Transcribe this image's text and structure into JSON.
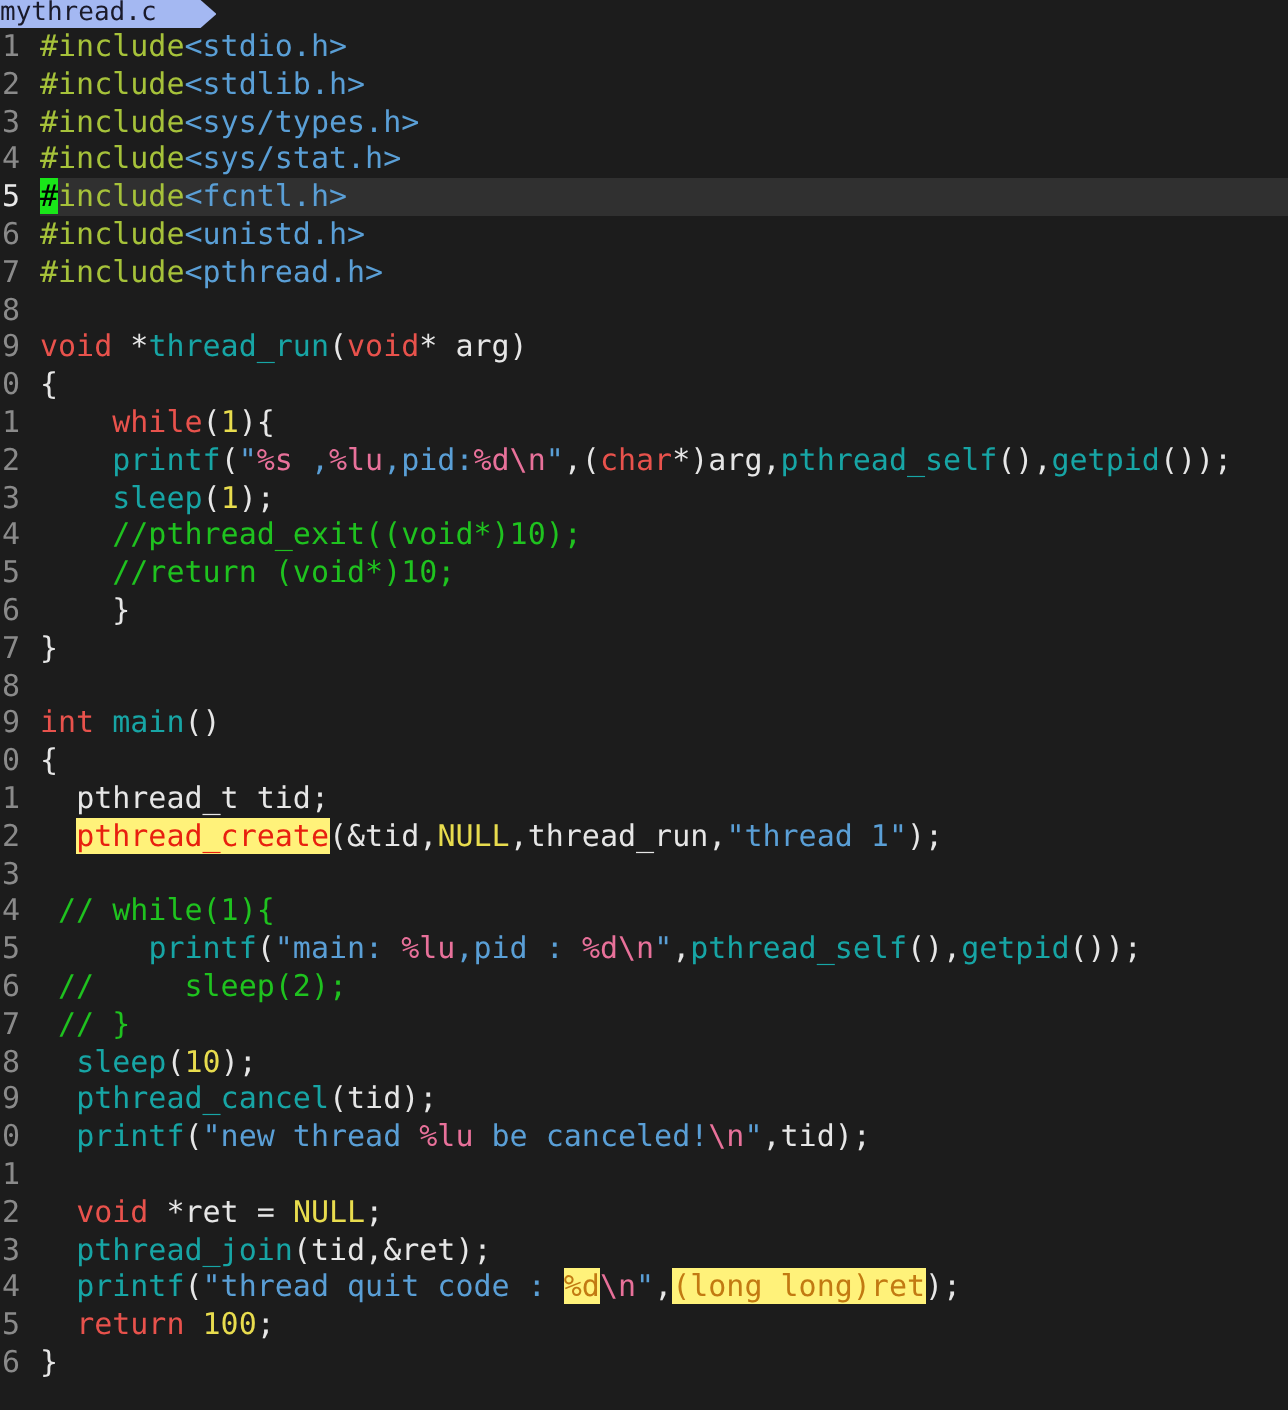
{
  "tab": {
    "title": "mythread.c"
  },
  "lines": [
    {
      "number": "1",
      "current": false,
      "segments": [
        {
          "text": "#include",
          "kind": "preproc"
        },
        {
          "text": "<stdio.h>",
          "kind": "header"
        }
      ]
    },
    {
      "number": "2",
      "current": false,
      "segments": [
        {
          "text": "#include",
          "kind": "preproc"
        },
        {
          "text": "<stdlib.h>",
          "kind": "header"
        }
      ]
    },
    {
      "number": "3",
      "current": false,
      "segments": [
        {
          "text": "#include",
          "kind": "preproc"
        },
        {
          "text": "<sys/types.h>",
          "kind": "header"
        }
      ]
    },
    {
      "number": "4",
      "current": false,
      "segments": [
        {
          "text": "#include",
          "kind": "preproc"
        },
        {
          "text": "<sys/stat.h>",
          "kind": "header"
        }
      ]
    },
    {
      "number": "5",
      "current": true,
      "segments": [
        {
          "text": "#",
          "kind": "cursor"
        },
        {
          "text": "include",
          "kind": "preproc"
        },
        {
          "text": "<fcntl.h>",
          "kind": "header"
        }
      ]
    },
    {
      "number": "6",
      "current": false,
      "segments": [
        {
          "text": "#include",
          "kind": "preproc"
        },
        {
          "text": "<unistd.h>",
          "kind": "header"
        }
      ]
    },
    {
      "number": "7",
      "current": false,
      "segments": [
        {
          "text": "#include",
          "kind": "preproc"
        },
        {
          "text": "<pthread.h>",
          "kind": "header"
        }
      ]
    },
    {
      "number": "8",
      "current": false
    },
    {
      "number": "9",
      "current": false,
      "segments": [
        {
          "text": "void",
          "kind": "keyword"
        },
        {
          "text": " *",
          "kind": "plain"
        },
        {
          "text": "thread_run",
          "kind": "function"
        },
        {
          "text": "(",
          "kind": "plain"
        },
        {
          "text": "void",
          "kind": "keyword"
        },
        {
          "text": "* arg)",
          "kind": "plain"
        }
      ]
    },
    {
      "number": "0",
      "current": false,
      "segments": [
        {
          "text": "{",
          "kind": "plain"
        }
      ]
    },
    {
      "number": "1",
      "current": false,
      "segments": [
        {
          "text": "    while",
          "kind": "keyword"
        },
        {
          "text": "(",
          "kind": "plain"
        },
        {
          "text": "1",
          "kind": "number"
        },
        {
          "text": "){",
          "kind": "plain"
        }
      ]
    },
    {
      "number": "2",
      "current": false,
      "segments": [
        {
          "text": "    printf",
          "kind": "function"
        },
        {
          "text": "(",
          "kind": "plain"
        },
        {
          "text": "\"",
          "kind": "string"
        },
        {
          "text": "%s",
          "kind": "format"
        },
        {
          "text": " ,",
          "kind": "string"
        },
        {
          "text": "%lu",
          "kind": "format"
        },
        {
          "text": ",pid:",
          "kind": "string"
        },
        {
          "text": "%d\\n",
          "kind": "format"
        },
        {
          "text": "\"",
          "kind": "string"
        },
        {
          "text": ",(",
          "kind": "plain"
        },
        {
          "text": "char",
          "kind": "keyword"
        },
        {
          "text": "*)arg,",
          "kind": "plain"
        },
        {
          "text": "pthread_self",
          "kind": "function"
        },
        {
          "text": "(),",
          "kind": "plain"
        },
        {
          "text": "getpid",
          "kind": "function"
        },
        {
          "text": "());",
          "kind": "plain"
        }
      ]
    },
    {
      "number": "3",
      "current": false,
      "segments": [
        {
          "text": "    sleep",
          "kind": "function"
        },
        {
          "text": "(",
          "kind": "plain"
        },
        {
          "text": "1",
          "kind": "number"
        },
        {
          "text": ");",
          "kind": "plain"
        }
      ]
    },
    {
      "number": "4",
      "current": false,
      "segments": [
        {
          "text": "    //pthread_exit((void*)10);",
          "kind": "comment"
        }
      ]
    },
    {
      "number": "5",
      "current": false,
      "segments": [
        {
          "text": "    //return (void*)10;",
          "kind": "comment"
        }
      ]
    },
    {
      "number": "6",
      "current": false,
      "segments": [
        {
          "text": "    }",
          "kind": "plain"
        }
      ]
    },
    {
      "number": "7",
      "current": false,
      "segments": [
        {
          "text": "}",
          "kind": "plain"
        }
      ]
    },
    {
      "number": "8",
      "current": false
    },
    {
      "number": "9",
      "current": false,
      "segments": [
        {
          "text": "int",
          "kind": "keyword"
        },
        {
          "text": " main",
          "kind": "function"
        },
        {
          "text": "()",
          "kind": "plain"
        }
      ]
    },
    {
      "number": "0",
      "current": false,
      "segments": [
        {
          "text": "{",
          "kind": "plain"
        }
      ]
    },
    {
      "number": "1",
      "current": false,
      "segments": [
        {
          "text": "  pthread_t tid;",
          "kind": "plain"
        }
      ]
    },
    {
      "number": "2",
      "current": false,
      "segments": [
        {
          "text": "  pthread_create",
          "kind": "function",
          "highlighted": true
        },
        {
          "text": "(&tid,",
          "kind": "plain"
        },
        {
          "text": "NULL",
          "kind": "number"
        },
        {
          "text": ",thread_run,",
          "kind": "plain"
        },
        {
          "text": "\"thread 1\"",
          "kind": "string"
        },
        {
          "text": ");",
          "kind": "plain"
        }
      ]
    },
    {
      "number": "3",
      "current": false
    },
    {
      "number": "4",
      "current": false,
      "segments": [
        {
          "text": " // while(1){",
          "kind": "comment"
        }
      ]
    },
    {
      "number": "5",
      "current": false,
      "segments": [
        {
          "text": "      printf",
          "kind": "function"
        },
        {
          "text": "(",
          "kind": "plain"
        },
        {
          "text": "\"main: ",
          "kind": "string"
        },
        {
          "text": "%lu",
          "kind": "format"
        },
        {
          "text": ",pid : ",
          "kind": "string"
        },
        {
          "text": "%d\\n",
          "kind": "format"
        },
        {
          "text": "\"",
          "kind": "string"
        },
        {
          "text": ",",
          "kind": "plain"
        },
        {
          "text": "pthread_self",
          "kind": "function"
        },
        {
          "text": "(),",
          "kind": "plain"
        },
        {
          "text": "getpid",
          "kind": "function"
        },
        {
          "text": "());",
          "kind": "plain"
        }
      ]
    },
    {
      "number": "6",
      "current": false,
      "segments": [
        {
          "text": " //     sleep(2);",
          "kind": "comment"
        }
      ]
    },
    {
      "number": "7",
      "current": false,
      "segments": [
        {
          "text": " // }",
          "kind": "comment"
        }
      ]
    },
    {
      "number": "8",
      "current": false,
      "segments": [
        {
          "text": "  sleep",
          "kind": "function"
        },
        {
          "text": "(",
          "kind": "plain"
        },
        {
          "text": "10",
          "kind": "number"
        },
        {
          "text": ");",
          "kind": "plain"
        }
      ]
    },
    {
      "number": "9",
      "current": false,
      "segments": [
        {
          "text": "  pthread_cancel",
          "kind": "function"
        },
        {
          "text": "(tid);",
          "kind": "plain"
        }
      ]
    },
    {
      "number": "0",
      "current": false,
      "segments": [
        {
          "text": "  printf",
          "kind": "function"
        },
        {
          "text": "(",
          "kind": "plain"
        },
        {
          "text": "\"new thread ",
          "kind": "string"
        },
        {
          "text": "%lu",
          "kind": "format"
        },
        {
          "text": " be canceled!",
          "kind": "string"
        },
        {
          "text": "\\n",
          "kind": "format"
        },
        {
          "text": "\"",
          "kind": "string"
        },
        {
          "text": ",tid);",
          "kind": "plain"
        }
      ]
    },
    {
      "number": "1",
      "current": false
    },
    {
      "number": "2",
      "current": false,
      "segments": [
        {
          "text": "  void",
          "kind": "keyword"
        },
        {
          "text": " *ret = ",
          "kind": "plain"
        },
        {
          "text": "NULL",
          "kind": "number"
        },
        {
          "text": ";",
          "kind": "plain"
        }
      ]
    },
    {
      "number": "3",
      "current": false,
      "segments": [
        {
          "text": "  pthread_join",
          "kind": "function"
        },
        {
          "text": "(tid,&ret);",
          "kind": "plain"
        }
      ]
    },
    {
      "number": "4",
      "current": false,
      "segments": [
        {
          "text": "  printf",
          "kind": "function"
        },
        {
          "text": "(",
          "kind": "plain"
        },
        {
          "text": "\"thread quit code : ",
          "kind": "string"
        },
        {
          "text": "%d",
          "kind": "format",
          "highlighted": true
        },
        {
          "text": "\\n",
          "kind": "format"
        },
        {
          "text": "\"",
          "kind": "string"
        },
        {
          "text": ",",
          "kind": "plain"
        },
        {
          "text": "(long long)ret",
          "kind": "plain",
          "highlighted": true
        },
        {
          "text": ");",
          "kind": "plain"
        }
      ]
    },
    {
      "number": "5",
      "current": false,
      "segments": [
        {
          "text": "  return",
          "kind": "keyword"
        },
        {
          "text": " 100",
          "kind": "number"
        },
        {
          "text": ";",
          "kind": "plain"
        }
      ]
    },
    {
      "number": "6",
      "current": false,
      "segments": [
        {
          "text": "}",
          "kind": "plain"
        }
      ]
    }
  ]
}
